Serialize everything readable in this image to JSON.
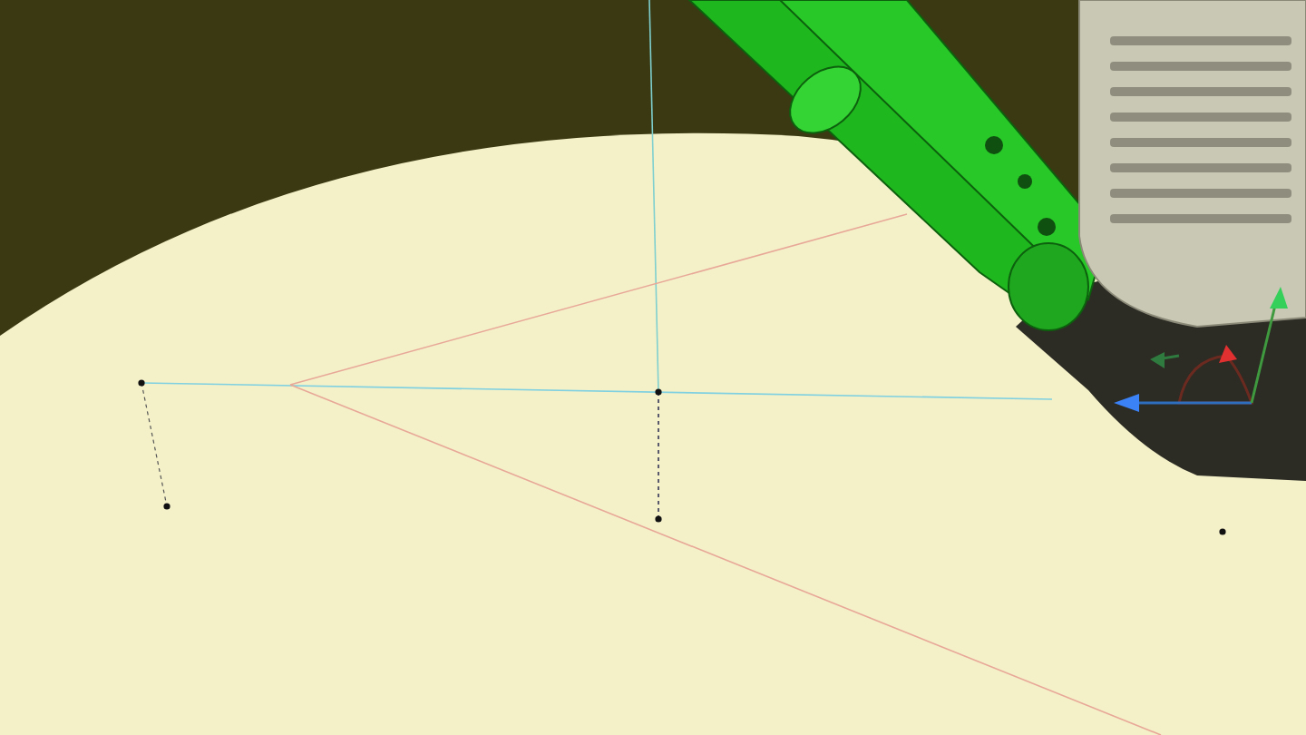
{
  "viewport": {
    "kind": "scene"
  }
}
